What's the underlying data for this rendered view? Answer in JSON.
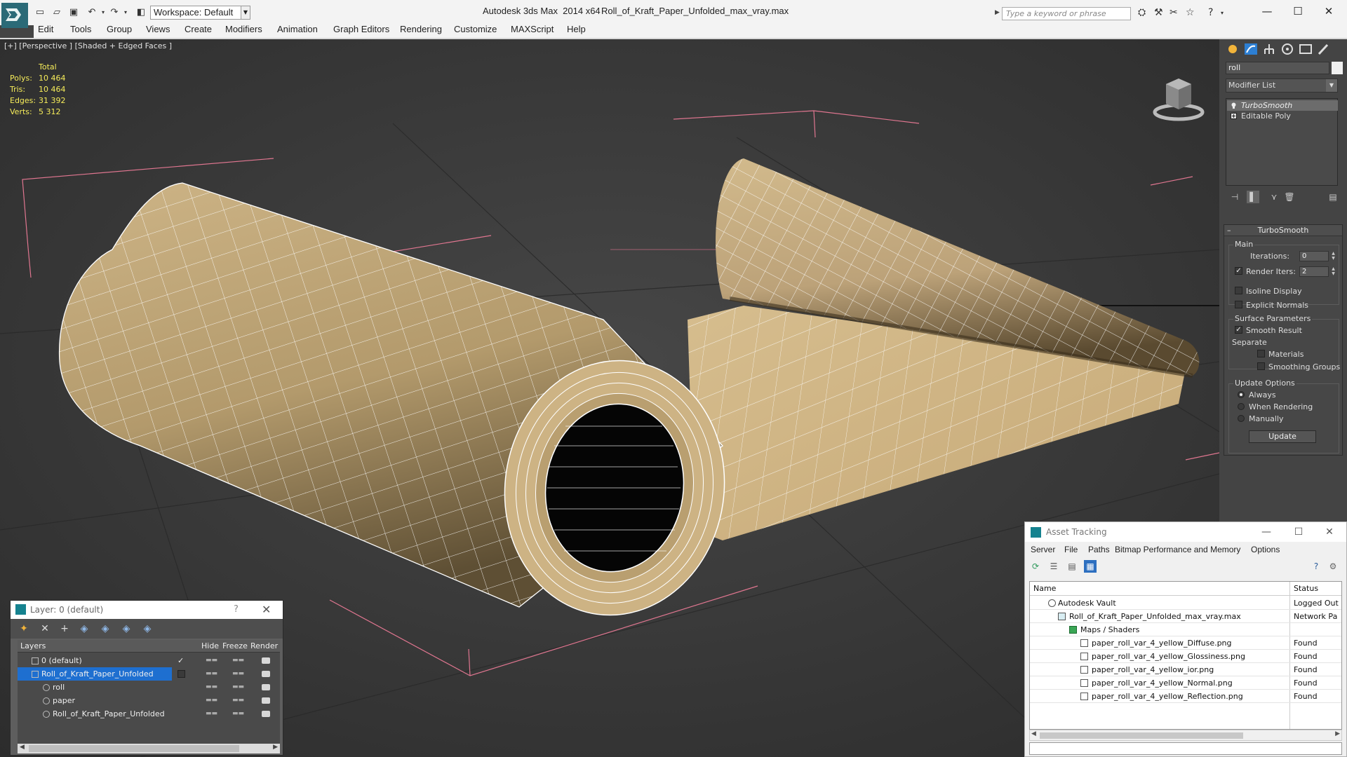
{
  "titlebar": {
    "workspace": "Workspace: Default",
    "app_title": "Autodesk 3ds Max  2014 x64",
    "file_title": "Roll_of_Kraft_Paper_Unfolded_max_vray.max",
    "search_placeholder": "Type a keyword or phrase"
  },
  "menu": [
    "Edit",
    "Tools",
    "Group",
    "Views",
    "Create",
    "Modifiers",
    "Animation",
    "Graph Editors",
    "Rendering",
    "Customize",
    "MAXScript",
    "Help"
  ],
  "viewport": {
    "label": "[+] [Perspective ] [Shaded + Edged Faces ]",
    "stats": {
      "header": "Total",
      "rows": [
        {
          "label": "Polys:",
          "value": "10 464"
        },
        {
          "label": "Tris:",
          "value": "10 464"
        },
        {
          "label": "Edges:",
          "value": "31 392"
        },
        {
          "label": "Verts:",
          "value": "5 312"
        }
      ]
    }
  },
  "command_panel": {
    "object_name": "roll",
    "modifier_list": "Modifier List",
    "stack": [
      "TurboSmooth",
      "Editable Poly"
    ],
    "turbosmooth": {
      "title": "TurboSmooth",
      "main_group": "Main",
      "iterations_label": "Iterations:",
      "iterations": "0",
      "render_iters_label": "Render Iters:",
      "render_iters": "2",
      "isoline": "Isoline Display",
      "explicit_normals": "Explicit Normals",
      "surface_group": "Surface Parameters",
      "smooth_result": "Smooth Result",
      "separate": "Separate",
      "materials": "Materials",
      "smoothing_groups": "Smoothing Groups",
      "update_group": "Update Options",
      "always": "Always",
      "when_rendering": "When Rendering",
      "manually": "Manually",
      "update_button": "Update"
    }
  },
  "layer_dialog": {
    "title": "Layer: 0 (default)",
    "help": "?",
    "columns": [
      "Layers",
      "Hide",
      "Freeze",
      "Render"
    ],
    "rows": [
      {
        "name": "0 (default)",
        "indent": 0
      },
      {
        "name": "Roll_of_Kraft_Paper_Unfolded",
        "indent": 0
      },
      {
        "name": "roll",
        "indent": 1
      },
      {
        "name": "paper",
        "indent": 1
      },
      {
        "name": "Roll_of_Kraft_Paper_Unfolded",
        "indent": 1
      }
    ]
  },
  "asset_dialog": {
    "title": "Asset Tracking",
    "menu": [
      "Server",
      "File",
      "Paths",
      "Bitmap Performance and Memory",
      "Options"
    ],
    "columns": [
      "Name",
      "Status"
    ],
    "rows": [
      {
        "name": "Autodesk Vault",
        "status": "Logged Out"
      },
      {
        "name": "Roll_of_Kraft_Paper_Unfolded_max_vray.max",
        "status": "Network Pa"
      },
      {
        "name": "Maps / Shaders",
        "status": ""
      },
      {
        "name": "paper_roll_var_4_yellow_Diffuse.png",
        "status": "Found"
      },
      {
        "name": "paper_roll_var_4_yellow_Glossiness.png",
        "status": "Found"
      },
      {
        "name": "paper_roll_var_4_yellow_ior.png",
        "status": "Found"
      },
      {
        "name": "paper_roll_var_4_yellow_Normal.png",
        "status": "Found"
      },
      {
        "name": "paper_roll_var_4_yellow_Reflection.png",
        "status": "Found"
      }
    ]
  },
  "colors": {
    "paper": "#c9ad7d",
    "wire": "#ffffff",
    "stats": "#f6ec5a",
    "selection": "#1e6fd0"
  }
}
